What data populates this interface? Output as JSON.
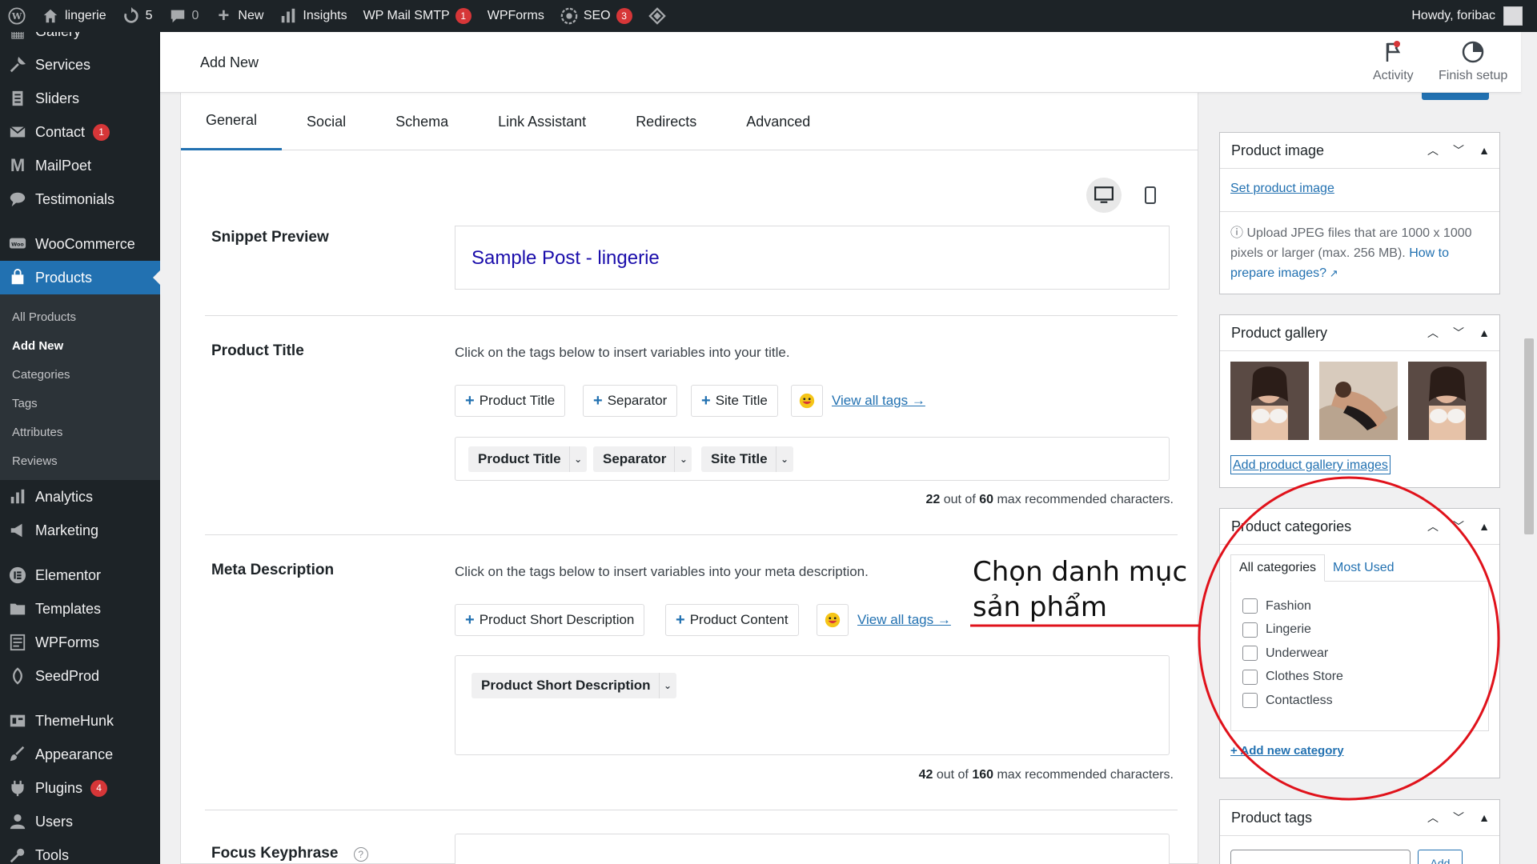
{
  "admin_bar": {
    "site_name": "lingerie",
    "updates_count": "5",
    "comments_count": "0",
    "new_label": "New",
    "insights_label": "Insights",
    "wp_mail_smtp_label": "WP Mail SMTP",
    "wp_mail_smtp_badge": "1",
    "wpforms_label": "WPForms",
    "seo_label": "SEO",
    "seo_badge": "3",
    "howdy": "Howdy, foribac"
  },
  "sidebar": {
    "items_top": [
      {
        "label": "Gallery",
        "icon": "gallery-icon"
      },
      {
        "label": "Services",
        "icon": "wrench-icon"
      },
      {
        "label": "Sliders",
        "icon": "document-icon"
      },
      {
        "label": "Contact",
        "icon": "mail-icon",
        "badge": "1"
      },
      {
        "label": "MailPoet",
        "icon": "mailpoet-icon"
      },
      {
        "label": "Testimonials",
        "icon": "speech-icon"
      }
    ],
    "woocommerce": "WooCommerce",
    "products": "Products",
    "products_submenu": [
      "All Products",
      "Add New",
      "Categories",
      "Tags",
      "Attributes",
      "Reviews"
    ],
    "items_bottom": [
      {
        "label": "Analytics",
        "icon": "bar-chart-icon"
      },
      {
        "label": "Marketing",
        "icon": "megaphone-icon"
      }
    ],
    "items_tools": [
      {
        "label": "Elementor",
        "icon": "elementor-icon"
      },
      {
        "label": "Templates",
        "icon": "folder-icon"
      },
      {
        "label": "WPForms",
        "icon": "form-icon"
      },
      {
        "label": "SeedProd",
        "icon": "seedprod-icon"
      }
    ],
    "items_site": [
      {
        "label": "ThemeHunk",
        "icon": "themehunk-icon"
      },
      {
        "label": "Appearance",
        "icon": "brush-icon"
      },
      {
        "label": "Plugins",
        "icon": "plug-icon",
        "badge": "4"
      },
      {
        "label": "Users",
        "icon": "user-icon"
      },
      {
        "label": "Tools",
        "icon": "tools-icon"
      }
    ]
  },
  "header": {
    "title": "Add New",
    "activity": "Activity",
    "finish_setup": "Finish setup"
  },
  "seo": {
    "tabs": [
      "General",
      "Social",
      "Schema",
      "Link Assistant",
      "Redirects",
      "Advanced"
    ],
    "snippet_label": "Snippet Preview",
    "snippet_title": "Sample Post - lingerie",
    "title_label": "Product Title",
    "title_hint": "Click on the tags below to insert variables into your title.",
    "title_tags": [
      "Product Title",
      "Separator",
      "Site Title"
    ],
    "view_all_tags": "View all tags →",
    "title_chips": [
      "Product Title",
      "Separator",
      "Site Title"
    ],
    "title_count_num": "22",
    "title_count_mid": " out of ",
    "title_count_max": "60",
    "title_count_tail": " max recommended characters.",
    "meta_label": "Meta Description",
    "meta_hint": "Click on the tags below to insert variables into your meta description.",
    "meta_tags": [
      "Product Short Description",
      "Product Content"
    ],
    "meta_chip": "Product Short Description",
    "meta_count_num": "42",
    "meta_count_mid": " out of ",
    "meta_count_max": "160",
    "meta_count_tail": " max recommended characters.",
    "focus_label": "Focus Keyphrase"
  },
  "right": {
    "product_image_title": "Product image",
    "set_product_image": "Set product image",
    "upload_note": "Upload JPEG files that are 1000 x 1000 pixels or larger (max. 256 MB).",
    "how_to_link": "How to prepare images?",
    "gallery_title": "Product gallery",
    "add_gallery": "Add product gallery images",
    "categories_title": "Product categories",
    "cat_tab_all": "All categories",
    "cat_tab_used": "Most Used",
    "categories": [
      "Fashion",
      "Lingerie",
      "Underwear",
      "Clothes Store",
      "Contactless"
    ],
    "add_category": "+ Add new category",
    "tags_title": "Product tags",
    "tags_add": "Add"
  },
  "annotation": {
    "line1": "Chọn danh mục",
    "line2": "sản phẩm",
    "color": "#e0121b"
  }
}
